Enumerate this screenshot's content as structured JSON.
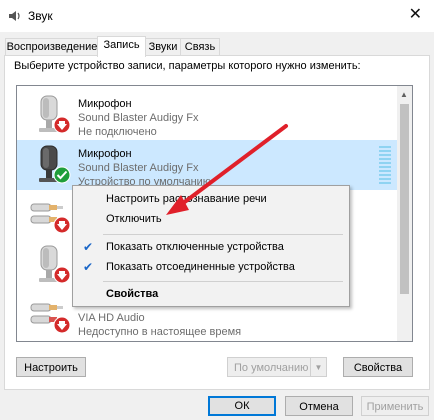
{
  "window": {
    "title": "Звук"
  },
  "tabs": [
    {
      "label": "Воспроизведение",
      "active": false
    },
    {
      "label": "Запись",
      "active": true
    },
    {
      "label": "Звуки",
      "active": false
    },
    {
      "label": "Связь",
      "active": false
    }
  ],
  "instruction": "Выберите устройство записи, параметры которого нужно изменить:",
  "devices": [
    {
      "name": "Микрофон",
      "model": "Sound Blaster Audigy Fx",
      "status": "Не подключено",
      "badge": "down-arrow"
    },
    {
      "name": "Микрофон",
      "model": "Sound Blaster Audigy Fx",
      "status": "Устройство по умолчанию",
      "badge": "check",
      "selected": true
    },
    {
      "name": "",
      "model": "",
      "status": "",
      "badge": "down-arrow"
    },
    {
      "name": "",
      "model": "",
      "status": "",
      "badge": "down-arrow"
    },
    {
      "name": "",
      "model": "VIA HD Audio",
      "status": "Недоступно в настоящее время",
      "badge": "down-arrow"
    }
  ],
  "context_menu": {
    "items": [
      {
        "label": "Настроить распознавание речи",
        "checked": false
      },
      {
        "label": "Отключить",
        "checked": false
      },
      {
        "label": "Показать отключенные устройства",
        "checked": true
      },
      {
        "label": "Показать отсоединенные устройства",
        "checked": true
      },
      {
        "label": "Свойства",
        "checked": false,
        "bold": true
      }
    ]
  },
  "buttons": {
    "configure": "Настроить",
    "set_default": "По умолчанию",
    "properties": "Свойства",
    "ok": "ОК",
    "cancel": "Отмена",
    "apply": "Применить"
  },
  "colors": {
    "accent": "#0078d7",
    "selection": "#cce8ff",
    "annotation_arrow": "#e0202a",
    "status_ok": "#1f9e3a",
    "status_disabled": "#d42a2a"
  }
}
